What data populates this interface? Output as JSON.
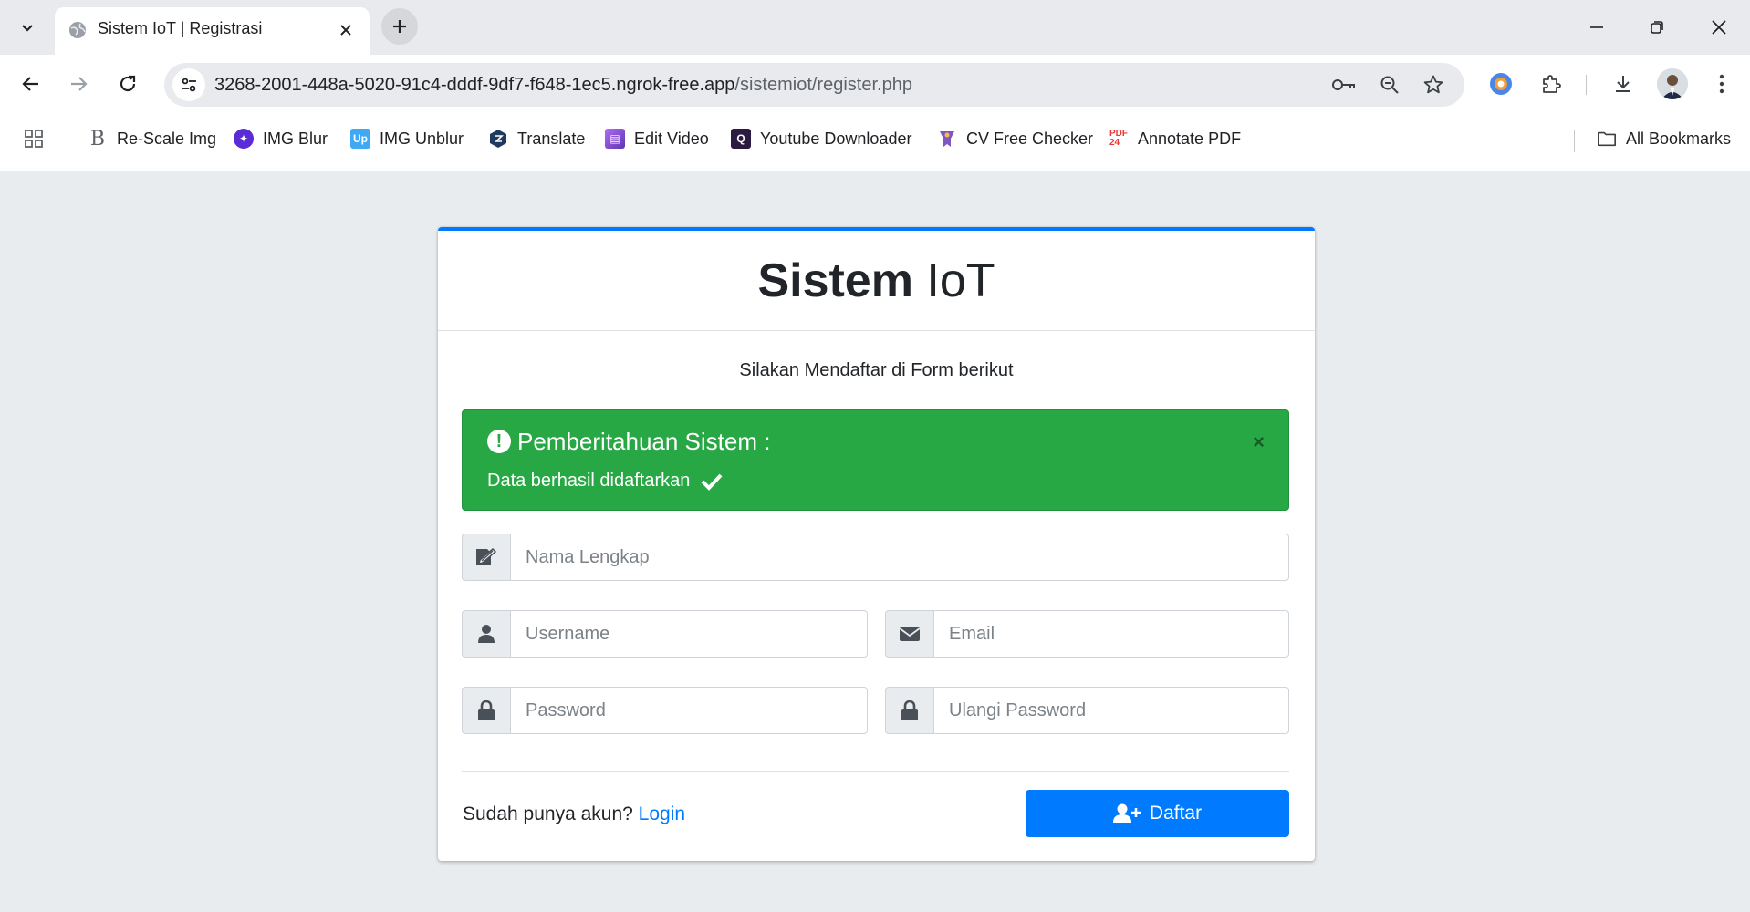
{
  "browser": {
    "tab_title": "Sistem IoT | Registrasi",
    "url_host": "3268-2001-448a-5020-91c4-dddf-9df7-f648-1ec5.ngrok-free.app",
    "url_path": "/sistemiot/register.php",
    "bookmarks": [
      {
        "label": "Re-Scale Img",
        "icon": "rescale-icon",
        "color": "#5f6368"
      },
      {
        "label": "IMG Blur",
        "icon": "img-blur-icon",
        "color": "#5b2bd6"
      },
      {
        "label": "IMG Unblur",
        "icon": "img-unblur-icon",
        "color": "#3fa9f5"
      },
      {
        "label": "Translate",
        "icon": "translate-icon",
        "color": "#1f3a5f"
      },
      {
        "label": "Edit Video",
        "icon": "edit-video-icon",
        "color": "#7b3fe4"
      },
      {
        "label": "Youtube Downloader",
        "icon": "youtube-downloader-icon",
        "color": "#2b1b40"
      },
      {
        "label": "CV Free Checker",
        "icon": "cv-checker-icon",
        "color": "#7e57c2"
      },
      {
        "label": "Annotate PDF",
        "icon": "pdf-icon",
        "color": "#e53935"
      }
    ],
    "all_bookmarks": "All Bookmarks"
  },
  "page": {
    "brand_bold": "Sistem",
    "brand_light": "IoT",
    "subtitle": "Silakan Mendaftar di Form berikut",
    "alert": {
      "title": "Pemberitahuan Sistem :",
      "message": "Data berhasil didaftarkan",
      "close": "×",
      "color": "#28a745"
    },
    "form": {
      "fullname_placeholder": "Nama Lengkap",
      "username_placeholder": "Username",
      "email_placeholder": "Email",
      "password_placeholder": "Password",
      "repeat_password_placeholder": "Ulangi Password"
    },
    "account_question": "Sudah punya akun?",
    "login_link": "Login",
    "register_button": "Daftar",
    "accent_color": "#007bff"
  }
}
